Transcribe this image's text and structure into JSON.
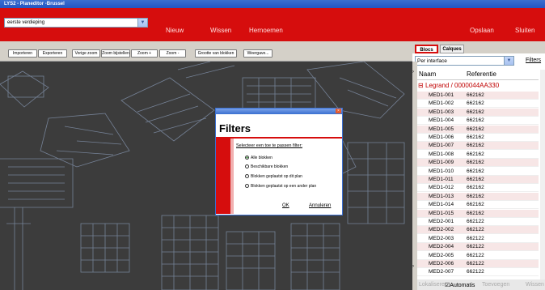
{
  "window": {
    "title": "LYS2 - Planeditor -Brussel"
  },
  "top": {
    "floor": "eerste verdieping",
    "menu": [
      "Nieuw",
      "Wissen",
      "Hernoemen"
    ],
    "save": "Opslaan",
    "close": "Sluiten"
  },
  "toolbar": {
    "buttons": [
      "Importeren",
      "Exporteren",
      "Vorige zoom",
      "Zoom bijstellen",
      "Zoom +",
      "Zoom -",
      "Grootte van blokken",
      "Weergave..."
    ]
  },
  "dialog": {
    "title": "Filters",
    "prompt": "Selecteer een toe te passen filter:",
    "options": [
      "Alle blokken",
      "Beschikbare blokken",
      "Blokken geplaatst op dit plan",
      "Blokken geplaatst op een ander plan"
    ],
    "ok": "OK",
    "cancel": "Annuleren"
  },
  "panel": {
    "tabs": [
      "Blocs",
      "Calques"
    ],
    "filter_value": "Per interface",
    "filters_link": "Filters",
    "columns": [
      "Naam",
      "Referentie"
    ],
    "group": "Legrand / 0000044AA330",
    "rows": [
      {
        "name": "MED1-001",
        "ref": "662162"
      },
      {
        "name": "MED1-002",
        "ref": "662162"
      },
      {
        "name": "MED1-003",
        "ref": "662162"
      },
      {
        "name": "MED1-004",
        "ref": "662162"
      },
      {
        "name": "MED1-005",
        "ref": "662162"
      },
      {
        "name": "MED1-006",
        "ref": "662162"
      },
      {
        "name": "MED1-007",
        "ref": "662162"
      },
      {
        "name": "MED1-008",
        "ref": "662162"
      },
      {
        "name": "MED1-009",
        "ref": "662162"
      },
      {
        "name": "MED1-010",
        "ref": "662162"
      },
      {
        "name": "MED1-011",
        "ref": "662162"
      },
      {
        "name": "MED1-012",
        "ref": "662162"
      },
      {
        "name": "MED1-013",
        "ref": "662162"
      },
      {
        "name": "MED1-014",
        "ref": "662162"
      },
      {
        "name": "MED1-015",
        "ref": "662162"
      },
      {
        "name": "MED2-001",
        "ref": "662122"
      },
      {
        "name": "MED2-002",
        "ref": "662122"
      },
      {
        "name": "MED2-003",
        "ref": "662122"
      },
      {
        "name": "MED2-004",
        "ref": "662122"
      },
      {
        "name": "MED2-005",
        "ref": "662122"
      },
      {
        "name": "MED2-006",
        "ref": "662122"
      },
      {
        "name": "MED2-007",
        "ref": "662122"
      }
    ],
    "bottom": {
      "left": "Lokaliseren",
      "check": "Automatis",
      "mid": "Toevoegen",
      "right": "Wissen"
    }
  },
  "colors": {
    "accent": "#d60d0d",
    "titlebar": "#2455c2"
  }
}
